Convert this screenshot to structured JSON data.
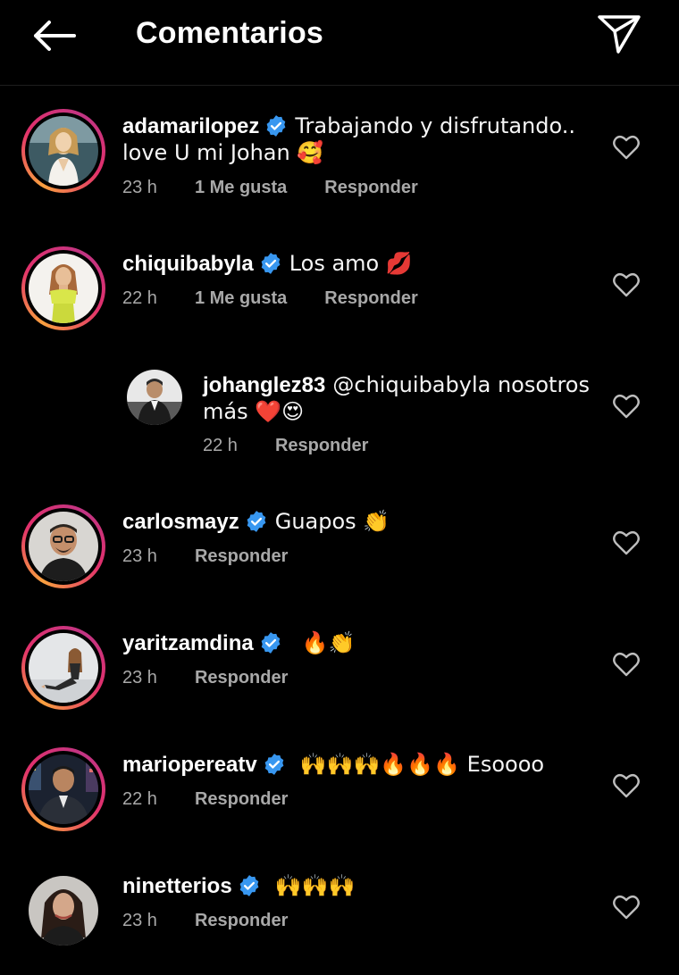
{
  "header": {
    "title": "Comentarios",
    "back_icon": "arrow-left-icon",
    "send_icon": "paper-plane-icon"
  },
  "comments": [
    {
      "username": "adamarilopez",
      "text_line1": "Trabajando y disfrutando..",
      "text_line2": "love U mi Johan 🥰",
      "time": "23 h",
      "likes": "1 Me gusta",
      "reply": "Responder"
    },
    {
      "username": "chiquibabyla",
      "text_line1": "Los amo 💋",
      "time": "22 h",
      "likes": "1 Me gusta",
      "reply": "Responder"
    },
    {
      "username": "johanglez83",
      "text_line1": "@chiquibabyla nosotros",
      "text_line2": "más ❤️😍",
      "time": "22 h",
      "reply": "Responder"
    },
    {
      "username": "carlosmayz",
      "text_line1": "Guapos 👏",
      "time": "23 h",
      "reply": "Responder"
    },
    {
      "username": "yaritzamdina",
      "text_line1": "🔥👏",
      "time": "23 h",
      "reply": "Responder"
    },
    {
      "username": "mariopereatv",
      "text_line1": "🙌🙌🙌🔥🔥🔥 Esoooo",
      "time": "22 h",
      "reply": "Responder"
    },
    {
      "username": "ninetterios",
      "text_line1": "🙌🙌🙌",
      "time": "23 h",
      "reply": "Responder"
    }
  ],
  "colors": {
    "background": "#000000",
    "text": "#f5f5f5",
    "meta": "#a8a8a8",
    "verified": "#3897f0"
  }
}
